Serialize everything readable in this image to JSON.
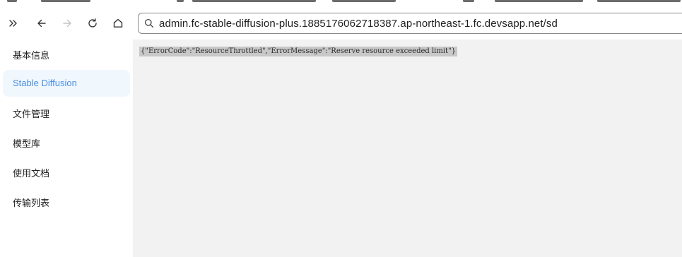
{
  "browser": {
    "address_url": "admin.fc-stable-diffusion-plus.1885176062718387.ap-northeast-1.fc.devsapp.net/sd",
    "icons": {
      "sidebar_toggle": "chevrons-right-icon",
      "back": "arrow-left-icon",
      "forward": "arrow-right-icon",
      "reload": "reload-icon",
      "home": "home-icon",
      "search": "search-icon"
    }
  },
  "sidebar": {
    "items": [
      {
        "label": "基本信息",
        "active": false
      },
      {
        "label": "Stable Diffusion",
        "active": true
      },
      {
        "label": "文件管理",
        "active": false
      },
      {
        "label": "模型库",
        "active": false
      },
      {
        "label": "使用文档",
        "active": false
      },
      {
        "label": "传输列表",
        "active": false
      }
    ]
  },
  "content": {
    "response_text": "{\"ErrorCode\":\"ResourceThrottled\",\"ErrorMessage\":\"Reserve resource exceeded limit\"}"
  },
  "colors": {
    "accent": "#4a90e2",
    "active_bg": "#f0f7fd",
    "content_bg": "#f2f2f2",
    "text_highlight": "#c8c8c8"
  }
}
